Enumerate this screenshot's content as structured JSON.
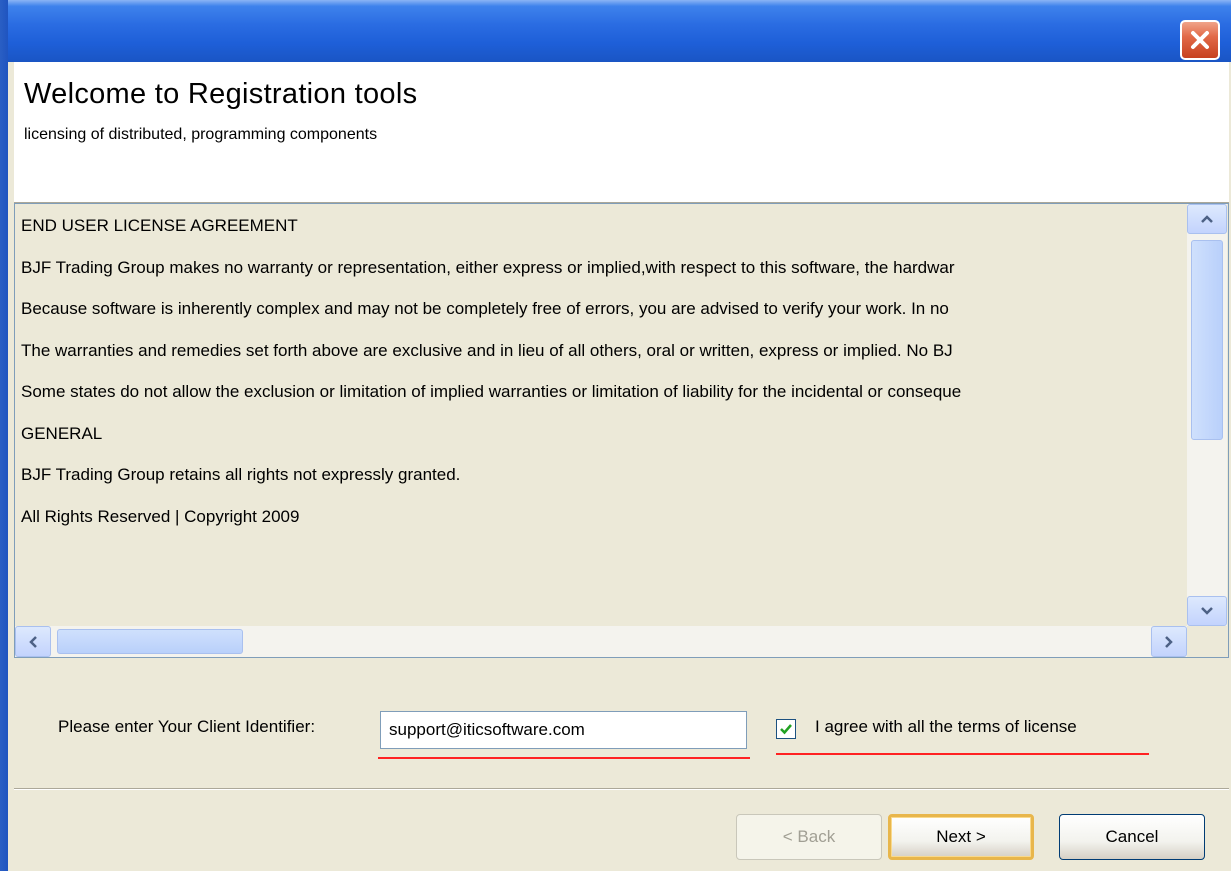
{
  "window": {
    "close_icon": "close-icon"
  },
  "header": {
    "title": "Welcome to Registration tools",
    "subtitle": "licensing of distributed, programming components"
  },
  "license": {
    "lines": [
      "END USER LICENSE AGREEMENT",
      "BJF Trading Group makes no warranty or representation, either express or implied,with respect to this software, the hardwar",
      "Because software is inherently complex and may not be completely free of errors, you are advised to verify your work.  In no",
      "The warranties and remedies set forth above are exclusive and in lieu of all others, oral or written, express or implied.  No BJ",
      "Some states do not allow the exclusion or limitation of implied warranties or limitation of liability for the incidental or conseque",
      "GENERAL",
      "BJF Trading Group retains all rights not expressly granted.",
      "All Rights Reserved | Copyright 2009"
    ]
  },
  "form": {
    "client_label": "Please enter Your Client Identifier:",
    "client_value": "support@iticsoftware.com",
    "agree_label": "I agree with all the terms of license",
    "agree_checked": true
  },
  "buttons": {
    "back": "< Back",
    "next": "Next >",
    "cancel": "Cancel"
  },
  "colors": {
    "title_bar": "#1e5fd8",
    "dialog_bg": "#ece9d8",
    "highlight_underline": "#ff2222"
  }
}
